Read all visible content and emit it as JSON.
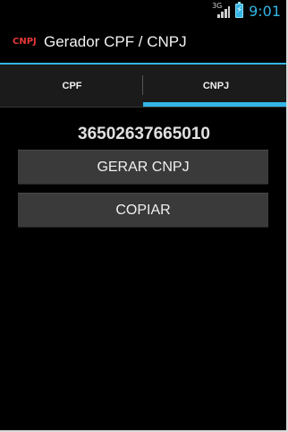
{
  "status_bar": {
    "network_type": "3G",
    "time": "9:01"
  },
  "action_bar": {
    "icon_text": "CNPJ",
    "title": "Gerador CPF / CNPJ"
  },
  "tabs": [
    {
      "label": "CPF",
      "selected": false
    },
    {
      "label": "CNPJ",
      "selected": true
    }
  ],
  "content": {
    "generated_number": "36502637665010",
    "generate_button_label": "GERAR CNPJ",
    "copy_button_label": "COPIAR"
  },
  "colors": {
    "accent": "#33b5e5",
    "icon_red": "#e53935",
    "button_bg": "#3a3a3a",
    "background": "#000000"
  }
}
